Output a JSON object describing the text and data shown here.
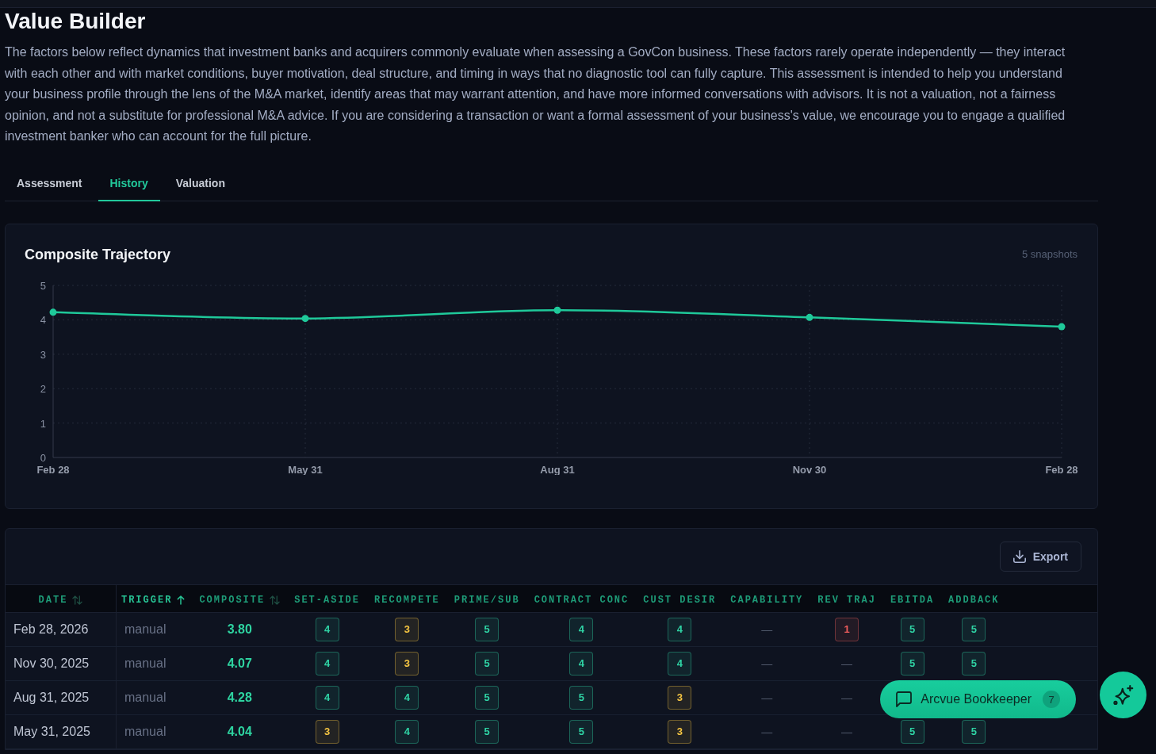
{
  "header": {
    "title": "Value Builder",
    "description": "The factors below reflect dynamics that investment banks and acquirers commonly evaluate when assessing a GovCon business. These factors rarely operate independently — they interact with each other and with market conditions, buyer motivation, deal structure, and timing in ways that no diagnostic tool can fully capture. This assessment is intended to help you understand your business profile through the lens of the M&A market, identify areas that may warrant attention, and have more informed conversations with advisors. It is not a valuation, not a fairness opinion, and not a substitute for professional M&A advice. If you are considering a transaction or want a formal assessment of your business's value, we encourage you to engage a qualified investment banker who can account for the full picture."
  },
  "tabs": [
    {
      "label": "Assessment",
      "selected": false
    },
    {
      "label": "History",
      "selected": true
    },
    {
      "label": "Valuation",
      "selected": false
    }
  ],
  "trajectory_card": {
    "subtitle": "5 snapshots",
    "chart_data": {
      "type": "line",
      "title": "Composite Trajectory",
      "categories": [
        "Feb 28",
        "May 31",
        "Aug 31",
        "Nov 30",
        "Feb 28"
      ],
      "series": [
        {
          "color": "#1fc99a",
          "marker": "circle",
          "values": [
            4.22,
            4.04,
            4.28,
            4.07,
            3.8
          ]
        }
      ],
      "ylim": [
        0,
        5
      ],
      "yticks": [
        0,
        1,
        2,
        3,
        4,
        5
      ],
      "grid": true
    }
  },
  "history_table": {
    "export_button": "Export",
    "columns": [
      {
        "label": "DATE",
        "sortable": true,
        "sorted": false
      },
      {
        "label": "TRIGGER",
        "sortable": true,
        "sorted": true
      },
      {
        "label": "COMPOSITE",
        "sortable": true,
        "sorted": false
      },
      {
        "label": "SET-ASIDE",
        "sortable": false,
        "sorted": false
      },
      {
        "label": "RECOMPETE",
        "sortable": false,
        "sorted": false
      },
      {
        "label": "PRIME/SUB",
        "sortable": false,
        "sorted": false
      },
      {
        "label": "CONTRACT CONC",
        "sortable": false,
        "sorted": false
      },
      {
        "label": "CUST DESIR",
        "sortable": false,
        "sorted": false
      },
      {
        "label": "CAPABILITY",
        "sortable": false,
        "sorted": false
      },
      {
        "label": "REV TRAJ",
        "sortable": false,
        "sorted": false
      },
      {
        "label": "EBITDA",
        "sortable": false,
        "sorted": false
      },
      {
        "label": "ADDBACK",
        "sortable": false,
        "sorted": false
      }
    ],
    "rows": [
      {
        "date": "Feb 28, 2026",
        "trigger": "manual",
        "composite": "3.80",
        "scores": [
          {
            "kind": "badge",
            "value": "4",
            "color": "#2fd3a4"
          },
          {
            "kind": "badge",
            "value": "3",
            "color": "#f5c542"
          },
          {
            "kind": "badge",
            "value": "5",
            "color": "#2fd3a4"
          },
          {
            "kind": "badge",
            "value": "4",
            "color": "#2fd3a4"
          },
          {
            "kind": "badge",
            "value": "4",
            "color": "#2fd3a4"
          },
          {
            "kind": "dash",
            "value": "—"
          },
          {
            "kind": "badge",
            "value": "1",
            "color": "#f05d5d"
          },
          {
            "kind": "badge",
            "value": "5",
            "color": "#2fd3a4"
          },
          {
            "kind": "badge",
            "value": "5",
            "color": "#2fd3a4"
          }
        ]
      },
      {
        "date": "Nov 30, 2025",
        "trigger": "manual",
        "composite": "4.07",
        "scores": [
          {
            "kind": "badge",
            "value": "4",
            "color": "#2fd3a4"
          },
          {
            "kind": "badge",
            "value": "3",
            "color": "#f5c542"
          },
          {
            "kind": "badge",
            "value": "5",
            "color": "#2fd3a4"
          },
          {
            "kind": "badge",
            "value": "4",
            "color": "#2fd3a4"
          },
          {
            "kind": "badge",
            "value": "4",
            "color": "#2fd3a4"
          },
          {
            "kind": "dash",
            "value": "—"
          },
          {
            "kind": "dash",
            "value": "—"
          },
          {
            "kind": "badge",
            "value": "5",
            "color": "#2fd3a4"
          },
          {
            "kind": "badge",
            "value": "5",
            "color": "#2fd3a4"
          }
        ]
      },
      {
        "date": "Aug 31, 2025",
        "trigger": "manual",
        "composite": "4.28",
        "scores": [
          {
            "kind": "badge",
            "value": "4",
            "color": "#2fd3a4"
          },
          {
            "kind": "badge",
            "value": "4",
            "color": "#2fd3a4"
          },
          {
            "kind": "badge",
            "value": "5",
            "color": "#2fd3a4"
          },
          {
            "kind": "badge",
            "value": "5",
            "color": "#2fd3a4"
          },
          {
            "kind": "badge",
            "value": "3",
            "color": "#f5c542"
          },
          {
            "kind": "dash",
            "value": "—"
          },
          {
            "kind": "dash",
            "value": "—"
          }
        ]
      },
      {
        "date": "May 31, 2025",
        "trigger": "manual",
        "composite": "4.04",
        "scores": [
          {
            "kind": "badge",
            "value": "3",
            "color": "#f5c542"
          },
          {
            "kind": "badge",
            "value": "4",
            "color": "#2fd3a4"
          },
          {
            "kind": "badge",
            "value": "5",
            "color": "#2fd3a4"
          },
          {
            "kind": "badge",
            "value": "5",
            "color": "#2fd3a4"
          },
          {
            "kind": "badge",
            "value": "3",
            "color": "#f5c542"
          },
          {
            "kind": "dash",
            "value": "—"
          },
          {
            "kind": "dash",
            "value": "—"
          },
          {
            "kind": "badge",
            "value": "5",
            "color": "#2fd3a4"
          },
          {
            "kind": "badge",
            "value": "5",
            "color": "#2fd3a4"
          }
        ]
      }
    ]
  },
  "assistant_button": {
    "label": "Arcvue Bookkeeper",
    "count": "7"
  }
}
